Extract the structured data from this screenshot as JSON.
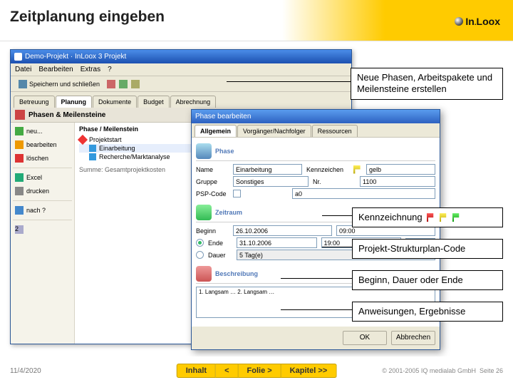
{
  "slide": {
    "title": "Zeitplanung eingeben"
  },
  "logo": {
    "text1": "In",
    "text2": "Loox",
    "dot": "."
  },
  "app": {
    "title": "Demo-Projekt · InLoox 3 Projekt",
    "menus": [
      "Datei",
      "Bearbeiten",
      "Extras",
      "?"
    ],
    "toolbar": {
      "save_close": "Speichern und schließen"
    },
    "tabs": [
      "Betreuung",
      "Planung",
      "Dokumente",
      "Budget",
      "Abrechnung"
    ],
    "active_tab": 1,
    "section": "Phasen & Meilensteine",
    "left_panel": {
      "new": "neu...",
      "edit": "bearbeiten",
      "delete": "löschen",
      "excel": "Excel",
      "print": "drucken",
      "pref": "nach ?"
    },
    "tree": {
      "header": "Phase / Meilenstein",
      "root": "Projektstart",
      "items": [
        "Einarbeitung",
        "Recherche/Marktanalyse"
      ],
      "summary": "Summe: Gesamtprojektkosten"
    }
  },
  "dialog": {
    "title": "Phase bearbeiten",
    "tabs": [
      "Allgemein",
      "Vorgänger/Nachfolger",
      "Ressourcen"
    ],
    "groups": {
      "phase": "Phase",
      "zeitraum": "Zeitraum",
      "beschreibung": "Beschreibung"
    },
    "labels": {
      "name": "Name",
      "gruppe": "Gruppe",
      "psp": "PSP-Code",
      "kennzeichen": "Kennzeichen",
      "nr": "Nr.",
      "beginn": "Beginn",
      "ende": "Ende",
      "dauer": "Dauer"
    },
    "values": {
      "name": "Einarbeitung",
      "gruppe": "Sonstiges",
      "kennzeichen": "gelb",
      "nr": "1100",
      "psp": "a0",
      "beginn_date": "26.10.2006",
      "beginn_time": "09:00",
      "ende_date": "31.10.2006",
      "ende_time": "19:00",
      "dauer": "5 Tag(e)",
      "memo": "1. Langsam …\n2. Langsam …"
    },
    "buttons": {
      "ok": "OK",
      "cancel": "Abbrechen"
    }
  },
  "callouts": {
    "c1": "Neue Phasen, Arbeitspakete und Meilensteine erstellen",
    "c2": "Kennzeichnung",
    "c3": "Projekt-Strukturplan-Code",
    "c4": "Beginn, Dauer oder Ende",
    "c5": "Anweisungen, Ergebnisse"
  },
  "footer": {
    "date": "11/4/2020",
    "nav": {
      "inhalt": "Inhalt",
      "prev": "<",
      "folie": "Folie >",
      "kapitel": "Kapitel >>"
    },
    "copyright": "© 2001-2005 IQ medialab GmbH",
    "page": "Seite 26"
  }
}
